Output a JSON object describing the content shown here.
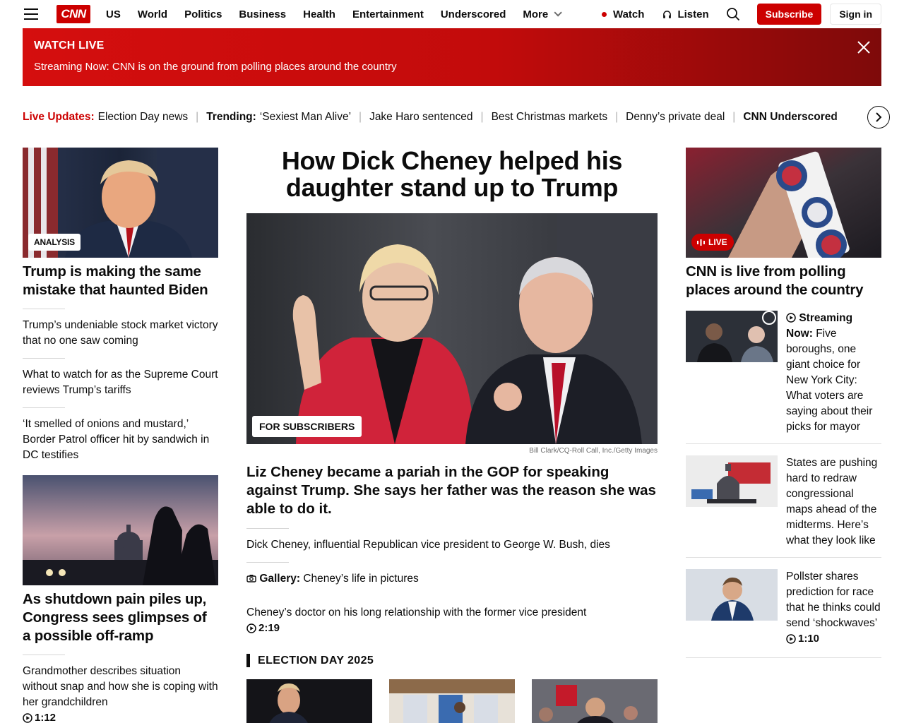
{
  "header": {
    "nav": [
      "US",
      "World",
      "Politics",
      "Business",
      "Health",
      "Entertainment",
      "Underscored"
    ],
    "more_label": "More",
    "watch_label": "Watch",
    "listen_label": "Listen",
    "subscribe_label": "Subscribe",
    "signin_label": "Sign in",
    "logo_text": "CNN"
  },
  "banner": {
    "title": "WATCH LIVE",
    "text": "Streaming Now: CNN is on the ground from polling places around the country"
  },
  "ticker": [
    {
      "label": "Live Updates:",
      "text": "Election Day news",
      "live": true
    },
    {
      "label": "Trending:",
      "text": "‘Sexiest Man Alive’"
    },
    {
      "label": "",
      "text": "Jake Haro sentenced"
    },
    {
      "label": "",
      "text": "Best Christmas markets"
    },
    {
      "label": "",
      "text": "Denny’s private deal"
    },
    {
      "label": "CNN Underscored",
      "text": ""
    }
  ],
  "left": {
    "lead_tag": "ANALYSIS",
    "lead_headline": "Trump is making the same mistake that haunted Biden",
    "links": [
      "Trump’s undeniable stock market victory that no one saw coming",
      "What to watch for as the Supreme Court reviews Trump’s tariffs",
      "‘It smelled of onions and mustard,’ Border Patrol officer hit by sandwich in DC testifies"
    ],
    "second_headline": "As shutdown pain piles up, Congress sees glimpses of a possible off-ramp",
    "video_link": "Grandmother describes situation without snap and how she is coping with her grandchildren",
    "video_duration": "1:12"
  },
  "center": {
    "headline": "How Dick Cheney helped his daughter stand up to Trump",
    "image_tag": "FOR SUBSCRIBERS",
    "credit": "Bill Clark/CQ-Roll Call, Inc./Getty Images",
    "subhead": "Liz Cheney became a pariah in the GOP for speaking against Trump. She says her father was the reason she was able to do it.",
    "link1": "Dick Cheney, influential Republican vice president to George W. Bush, dies",
    "gallery_label": "Gallery:",
    "gallery_text": "Cheney’s life in pictures",
    "video_text": "Cheney’s doctor on his long relationship with the former vice president",
    "video_duration": "2:19",
    "section_title": "ELECTION DAY 2025"
  },
  "right": {
    "lead_tag": "LIVE",
    "lead_headline": "CNN is live from polling places around the country",
    "items": [
      {
        "prefix": "Streaming Now:",
        "text": "Five boroughs, one giant choice for New York City: What voters are saying about their picks for mayor"
      },
      {
        "prefix": "",
        "text": "States are pushing hard to redraw congressional maps ahead of the midterms. Here’s what they look like"
      },
      {
        "prefix": "",
        "text": "Pollster shares prediction for race that he thinks could send ‘shockwaves’",
        "duration": "1:10"
      }
    ]
  },
  "colors": {
    "brand_red": "#cc0000",
    "text": "#0c0c0c"
  }
}
